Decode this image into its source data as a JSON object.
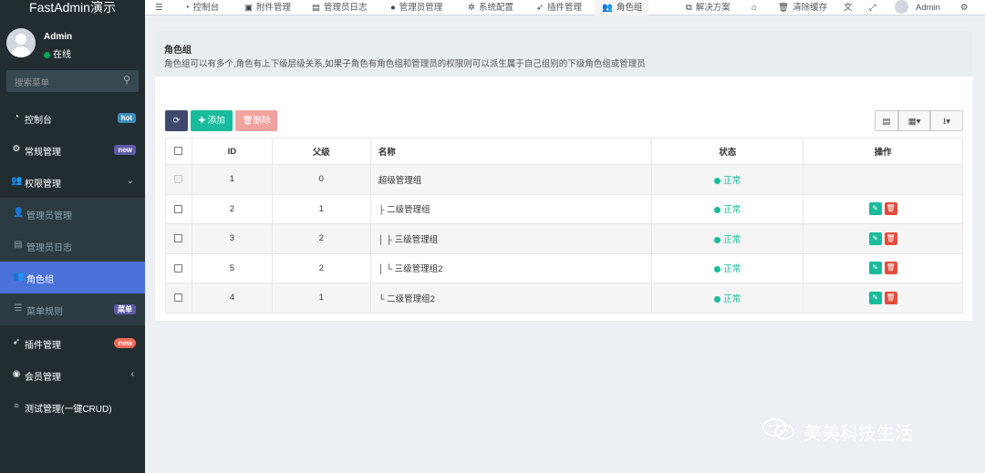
{
  "app": {
    "title": "FastAdmin演示"
  },
  "user": {
    "name": "Admin",
    "status": "在线"
  },
  "search": {
    "placeholder": "搜索菜单"
  },
  "sidebar": {
    "items": [
      {
        "label": "控制台",
        "icon": "dashboard-icon",
        "badge": "hot",
        "badge_color": "#3c8dbc"
      },
      {
        "label": "常规管理",
        "icon": "cogs-icon",
        "badge": "new",
        "badge_color": "#605ca8"
      },
      {
        "label": "权限管理",
        "icon": "group-icon"
      },
      {
        "label": "管理员管理",
        "icon": "user-icon"
      },
      {
        "label": "管理员日志",
        "icon": "list-alt-icon"
      },
      {
        "label": "角色组",
        "icon": "group-icon"
      },
      {
        "label": "菜单规则",
        "icon": "bars-icon",
        "badge": "菜单",
        "badge_color": "#605ca8"
      },
      {
        "label": "插件管理",
        "icon": "rocket-icon",
        "badge": "new",
        "badge_color": "#f56954"
      },
      {
        "label": "会员管理",
        "icon": "user-circle-icon"
      },
      {
        "label": "测试管理(一键CRUD)",
        "icon": "circle-icon"
      }
    ]
  },
  "navbar": {
    "tabs": [
      {
        "label": "控制台",
        "icon": "dashboard-icon"
      },
      {
        "label": "附件管理",
        "icon": "file-image-icon"
      },
      {
        "label": "管理员日志",
        "icon": "list-alt-icon"
      },
      {
        "label": "管理员管理",
        "icon": "user-icon"
      },
      {
        "label": "系统配置",
        "icon": "cog-icon"
      },
      {
        "label": "插件管理",
        "icon": "rocket-icon"
      },
      {
        "label": "角色组",
        "icon": "group-icon"
      }
    ],
    "right": {
      "solutions": "解决方案",
      "clear_cache": "清除缓存",
      "user": "Admin"
    }
  },
  "panel": {
    "title": "角色组",
    "description": "角色组可以有多个,角色有上下级层级关系,如果子角色有角色组和管理员的权限则可以派生属于自己组别的下级角色组或管理员"
  },
  "toolbar": {
    "add_label": "添加",
    "delete_label": "删除"
  },
  "table": {
    "headers": {
      "id": "ID",
      "pid": "父级",
      "name": "名称",
      "status": "状态",
      "operate": "操作"
    },
    "rows": [
      {
        "id": "1",
        "pid": "0",
        "name": "超级管理组",
        "status": "正常",
        "editable": false
      },
      {
        "id": "2",
        "pid": "1",
        "name": "├ 二级管理组",
        "status": "正常",
        "editable": true
      },
      {
        "id": "3",
        "pid": "2",
        "name": "│ ├ 三级管理组",
        "status": "正常",
        "editable": true
      },
      {
        "id": "5",
        "pid": "2",
        "name": "│ └ 三级管理组2",
        "status": "正常",
        "editable": true
      },
      {
        "id": "4",
        "pid": "1",
        "name": "└ 二级管理组2",
        "status": "正常",
        "editable": true
      }
    ]
  },
  "watermark": {
    "text": "美美科技生活"
  },
  "colors": {
    "sidebar_bg": "#222d32",
    "active_item": "#4a72d9",
    "success": "#18bc9c",
    "danger": "#e74c3c"
  }
}
